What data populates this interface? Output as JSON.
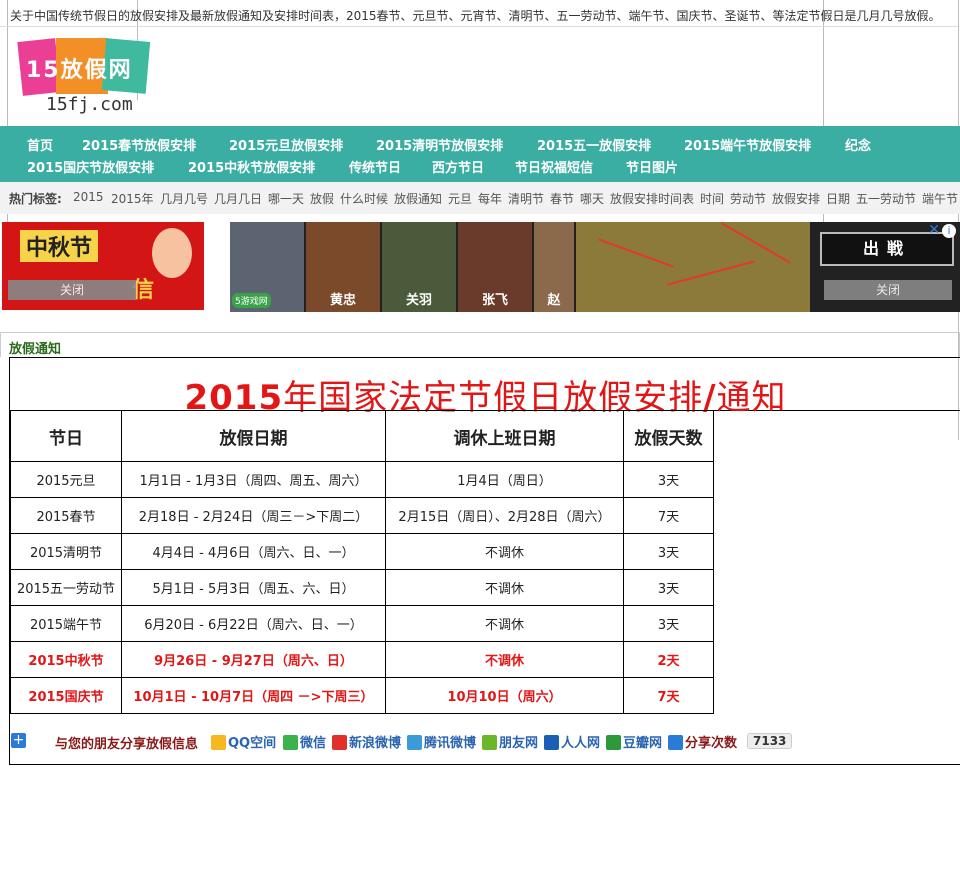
{
  "header": {
    "description": "关于中国传统节假日的放假安排及最新放假通知及安排时间表，2015春节、元旦节、元宵节、清明节、五一劳动节、端午节、国庆节、圣诞节、等法定节假日是几月几号放假。",
    "logo_text": "15放假网",
    "logo_domain": "15fj.com"
  },
  "nav": {
    "row1": [
      "首页",
      "2015春节放假安排",
      "2015元旦放假安排",
      "2015清明节放假安排",
      "2015五一放假安排",
      "2015端午节放假安排",
      "纪念"
    ],
    "row2": [
      "2015国庆节放假安排",
      "2015中秋节放假安排",
      "传统节日",
      "西方节日",
      "节日祝福短信",
      "节日图片"
    ]
  },
  "tags": {
    "label": "热门标签:",
    "items": [
      "2015",
      "2015年",
      "几月几号",
      "几月几日",
      "哪一天",
      "放假",
      "什么时候",
      "放假通知",
      "元旦",
      "每年",
      "清明节",
      "春节",
      "哪天",
      "放假安排时间表",
      "时间",
      "劳动节",
      "放假安排",
      "日期",
      "五一劳动节",
      "端午节"
    ]
  },
  "ads": {
    "left": {
      "line1": "中秋节",
      "line2": "信",
      "close": "关闭"
    },
    "banner": {
      "heroes": [
        "",
        "黄忠",
        "关羽",
        "张飞",
        "赵"
      ],
      "brand": "5游戏网",
      "button": "出戦",
      "close": "关闭",
      "info": "i",
      "x": "✕"
    }
  },
  "section": {
    "title": "放假通知"
  },
  "notice": {
    "title_num": "2015",
    "title_text": "年国家法定节假日放假安排",
    "title_slash": "/",
    "title_end": "通知",
    "headers": [
      "节日",
      "放假日期",
      "调休上班日期",
      "放假天数"
    ],
    "rows": [
      [
        "2015元旦",
        "1月1日 - 1月3日（周四、周五、周六）",
        "1月4日（周日）",
        "3天"
      ],
      [
        "2015春节",
        "2月18日 - 2月24日（周三－>下周二）",
        "2月15日（周日）、2月28日（周六）",
        "7天"
      ],
      [
        "2015清明节",
        "4月4日 - 4月6日（周六、日、一）",
        "不调休",
        "3天"
      ],
      [
        "2015五一劳动节",
        "5月1日 - 5月3日（周五、六、日）",
        "不调休",
        "3天"
      ],
      [
        "2015端午节",
        "6月20日 - 6月22日（周六、日、一）",
        "不调休",
        "3天"
      ],
      [
        "2015中秋节",
        "9月26日 - 9月27日（周六、日）",
        "不调休",
        "2天"
      ],
      [
        "2015国庆节",
        "10月1日 - 10月7日（周四 －>下周三）",
        "10月10日（周六）",
        "7天"
      ]
    ],
    "highlight_rows": [
      5,
      6
    ],
    "highlight_color": "#e31616"
  },
  "share": {
    "message": "与您的朋友分享放假信息",
    "items": [
      "QQ空间",
      "微信",
      "新浪微博",
      "腾讯微博",
      "朋友网",
      "人人网",
      "豆瓣网",
      "分享次数"
    ],
    "count": "7133"
  },
  "colors": {
    "nav_bg": "#3aaea2",
    "title_red": "#e31616"
  }
}
